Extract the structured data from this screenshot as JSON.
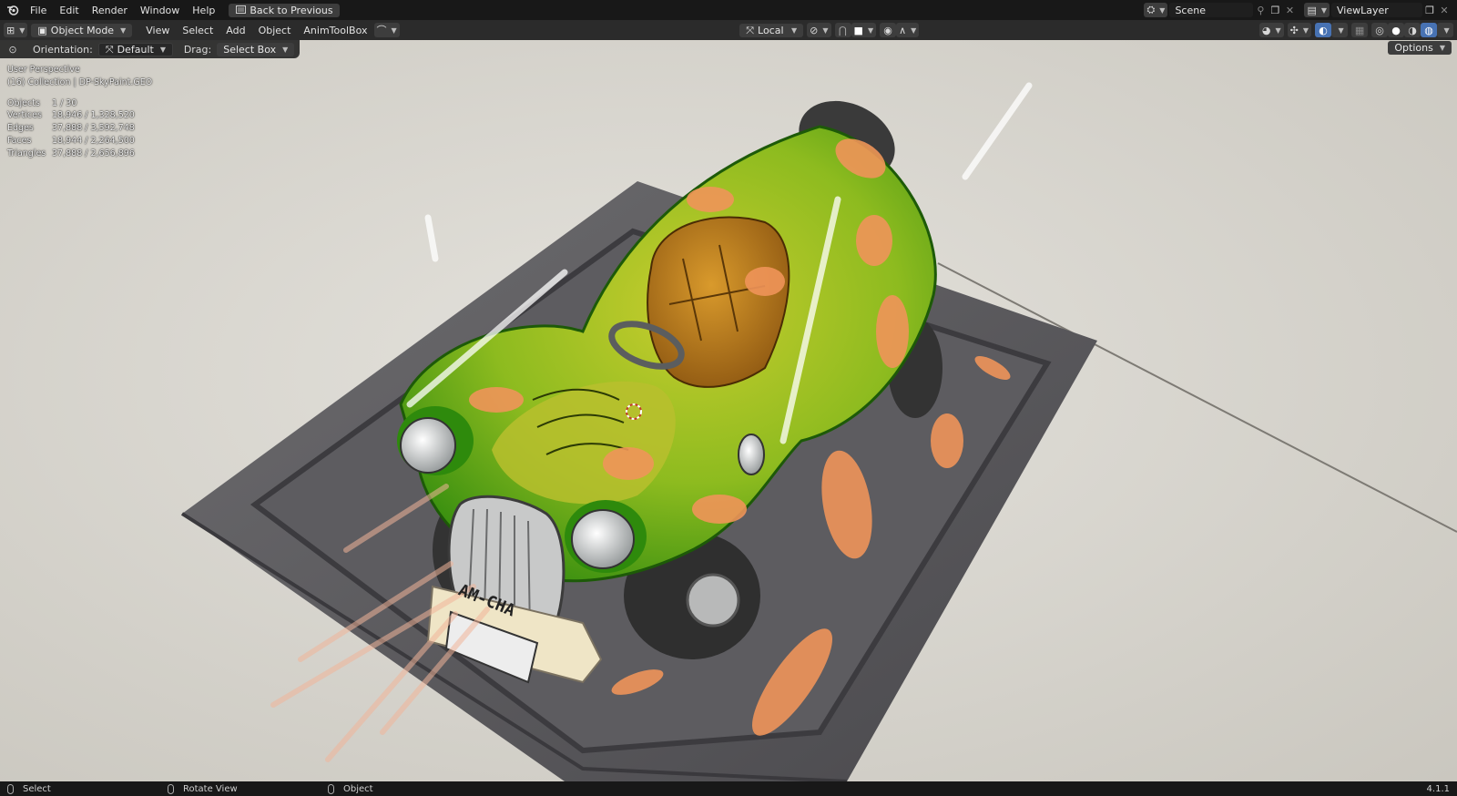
{
  "topbar": {
    "menus": [
      "File",
      "Edit",
      "Render",
      "Window",
      "Help"
    ],
    "back_button": "Back to Previous",
    "scene_name": "Scene",
    "view_layer": "ViewLayer"
  },
  "header": {
    "mode": "Object Mode",
    "menus": [
      "View",
      "Select",
      "Add",
      "Object",
      "AnimToolBox"
    ],
    "transform_orientation": "Local"
  },
  "tool_settings": {
    "orientation_label": "Orientation:",
    "orientation_value": "Default",
    "drag_label": "Drag:",
    "drag_value": "Select Box",
    "options_label": "Options"
  },
  "overlay": {
    "view_name": "User Perspective",
    "collection": "(16) Collection | DP-SkyPaint.GEO",
    "stats": [
      {
        "label": "Objects",
        "value": "1 / 30"
      },
      {
        "label": "Vertices",
        "value": "18,946 / 1,328,520"
      },
      {
        "label": "Edges",
        "value": "37,888 / 3,592,748"
      },
      {
        "label": "Faces",
        "value": "18,944 / 2,264,500"
      },
      {
        "label": "Triangles",
        "value": "37,888 / 2,656,896"
      }
    ]
  },
  "scene": {
    "license_plate": "AM-CHA"
  },
  "statusbar": {
    "left": "Select",
    "middle": "Rotate View",
    "right": "Object",
    "version": "4.1.1"
  },
  "colors": {
    "ui_dark": "#181818",
    "header": "#2b2b2b",
    "viewport_bg": "#d9d6cf",
    "car_green": "#3f9a12",
    "car_yellow": "#b5c424",
    "blossom": "#f0955a",
    "accent_blue": "#4772b3"
  }
}
